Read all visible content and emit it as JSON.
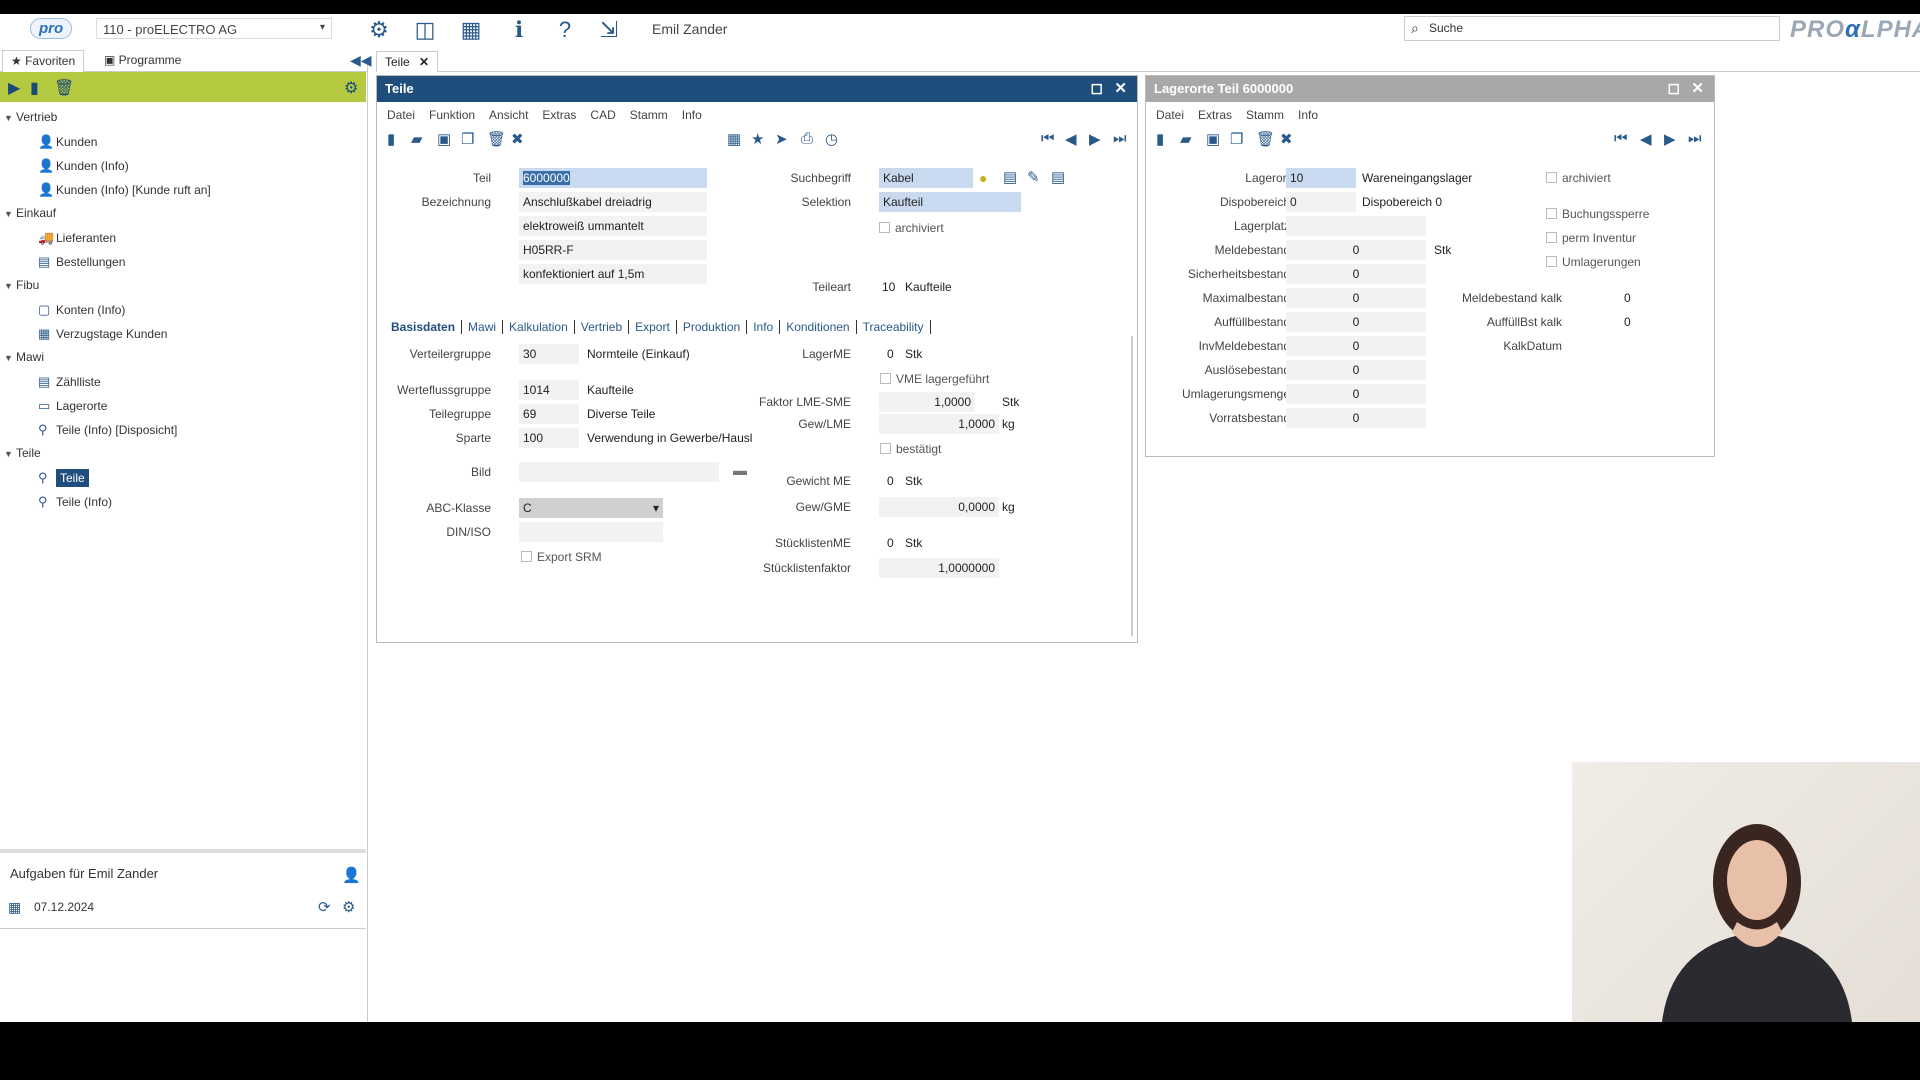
{
  "header": {
    "logo": "pro",
    "company": "110 - proELECTRO AG",
    "user": "Emil Zander",
    "search_placeholder": "Suche",
    "brand_left": "PRO",
    "brand_mid": "α",
    "brand_right": "LPHA"
  },
  "left": {
    "tab_favoriten": "Favoriten",
    "tab_programme": "Programme",
    "groups": [
      {
        "label": "Vertrieb",
        "items": [
          "Kunden",
          "Kunden (Info)",
          "Kunden (Info) [Kunde ruft an]"
        ]
      },
      {
        "label": "Einkauf",
        "items": [
          "Lieferanten",
          "Bestellungen"
        ]
      },
      {
        "label": "Fibu",
        "items": [
          "Konten (Info)",
          "Verzugstage Kunden"
        ]
      },
      {
        "label": "Mawi",
        "items": [
          "Zählliste",
          "Lagerorte",
          "Teile (Info) [Disposicht]"
        ]
      },
      {
        "label": "Teile",
        "items": [
          "Teile",
          "Teile (Info)"
        ]
      }
    ],
    "tasks_title": "Aufgaben für Emil Zander",
    "tasks_date": "07.12.2024"
  },
  "doctab": "Teile",
  "teile": {
    "title": "Teile",
    "menu": [
      "Datei",
      "Funktion",
      "Ansicht",
      "Extras",
      "CAD",
      "Stamm",
      "Info"
    ],
    "lbl_teil": "Teil",
    "teil": "6000000",
    "lbl_bez": "Bezeichnung",
    "bez1": "Anschlußkabel dreiadrig",
    "bez2": "elektroweiß ummantelt",
    "bez3": "H05RR-F",
    "bez4": "konfektioniert auf 1,5m",
    "lbl_such": "Suchbegriff",
    "such": "Kabel",
    "lbl_sel": "Selektion",
    "sel": "Kaufteil",
    "archiviert": "archiviert",
    "lbl_teileart": "Teileart",
    "teileart_code": "10",
    "teileart": "Kaufteile",
    "subtabs": [
      "Basisdaten",
      "Mawi",
      "Kalkulation",
      "Vertrieb",
      "Export",
      "Produktion",
      "Info",
      "Konditionen",
      "Traceability"
    ],
    "lbl_vg": "Verteilergruppe",
    "vg_code": "30",
    "vg": "Normteile (Einkauf)",
    "lbl_wfg": "Werteflussgruppe",
    "wfg_code": "1014",
    "wfg": "Kaufteile",
    "lbl_tg": "Teilegruppe",
    "tg_code": "69",
    "tg": "Diverse Teile",
    "lbl_sparte": "Sparte",
    "sparte_code": "100",
    "sparte": "Verwendung in Gewerbe/Hausl",
    "lbl_bild": "Bild",
    "lbl_abc": "ABC-Klasse",
    "abc": "C",
    "lbl_din": "DIN/ISO",
    "export_srm": "Export SRM",
    "lbl_lagerme": "LagerME",
    "lagerme_code": "0",
    "lagerme": "Stk",
    "vme": "VME lagergeführt",
    "lbl_faktor": "Faktor LME-SME",
    "faktor": "1,0000",
    "faktor_unit": "Stk",
    "lbl_gewlme": "Gew/LME",
    "gewlme": "1,0000",
    "gewlme_unit": "kg",
    "bestaetigt": "bestätigt",
    "lbl_gewme": "Gewicht ME",
    "gewme_code": "0",
    "gewme": "Stk",
    "lbl_gewgme": "Gew/GME",
    "gewgme": "0,0000",
    "gewgme_unit": "kg",
    "lbl_stlme": "StücklistenME",
    "stlme_code": "0",
    "stlme": "Stk",
    "lbl_stlf": "Stücklistenfaktor",
    "stlf": "1,0000000"
  },
  "lager": {
    "title": "Lagerorte Teil 6000000",
    "menu": [
      "Datei",
      "Extras",
      "Stamm",
      "Info"
    ],
    "lbl_lagerort": "Lagerort",
    "lagerort": "10",
    "lagerort_name": "Wareneingangslager",
    "lbl_dispo": "Dispobereich",
    "dispo": "0",
    "dispo_name": "Dispobereich 0",
    "lbl_platz": "Lagerplatz",
    "rows": [
      {
        "label": "Meldebestand",
        "value": "0"
      },
      {
        "label": "Sicherheitsbestand",
        "value": "0"
      },
      {
        "label": "Maximalbestand",
        "value": "0"
      },
      {
        "label": "Auffüllbestand",
        "value": "0"
      },
      {
        "label": "InvMeldebestand",
        "value": "0"
      },
      {
        "label": "Auslösebestand",
        "value": "0"
      },
      {
        "label": "Umlagerungsmenge",
        "value": "0"
      },
      {
        "label": "Vorratsbestand",
        "value": "0"
      }
    ],
    "stk": "Stk",
    "chk_archiviert": "archiviert",
    "chk_buchung": "Buchungssperre",
    "chk_perm": "perm Inventur",
    "chk_umlag": "Umlagerungen",
    "lbl_mbk": "Meldebestand kalk",
    "mbk": "0",
    "lbl_abk": "AuffüllBst kalk",
    "abk": "0",
    "lbl_kalkdatum": "KalkDatum"
  },
  "colors": {
    "accent": "#1f4e7d",
    "green": "#b5c940",
    "gray_title": "#a8a8a8"
  }
}
